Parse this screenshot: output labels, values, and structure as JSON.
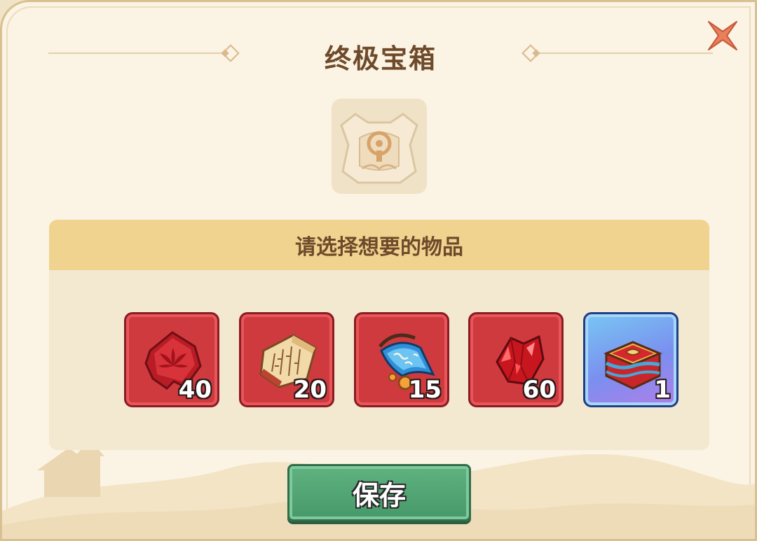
{
  "dialog": {
    "title": "终极宝箱",
    "close_icon": "close-x-icon",
    "chest_icon": "ultimate-chest-icon"
  },
  "selection": {
    "heading": "请选择想要的物品",
    "items": [
      {
        "icon": "red-puzzle-fragment-icon",
        "count": "40",
        "rarity": "red"
      },
      {
        "icon": "ancient-scroll-icon",
        "count": "20",
        "rarity": "red"
      },
      {
        "icon": "blue-sash-bell-icon",
        "count": "15",
        "rarity": "red"
      },
      {
        "icon": "red-crystal-icon",
        "count": "60",
        "rarity": "red"
      },
      {
        "icon": "ornate-box-icon",
        "count": "1",
        "rarity": "blue"
      }
    ]
  },
  "footer": {
    "save_label": "保存"
  },
  "colors": {
    "panel_bg": "#fbf3e3",
    "header_band": "#f0d38f",
    "item_red": "#cf3a3f",
    "item_blue": "#7a8ff0",
    "save_green": "#4fa371",
    "title_brown": "#6e4a2b"
  }
}
